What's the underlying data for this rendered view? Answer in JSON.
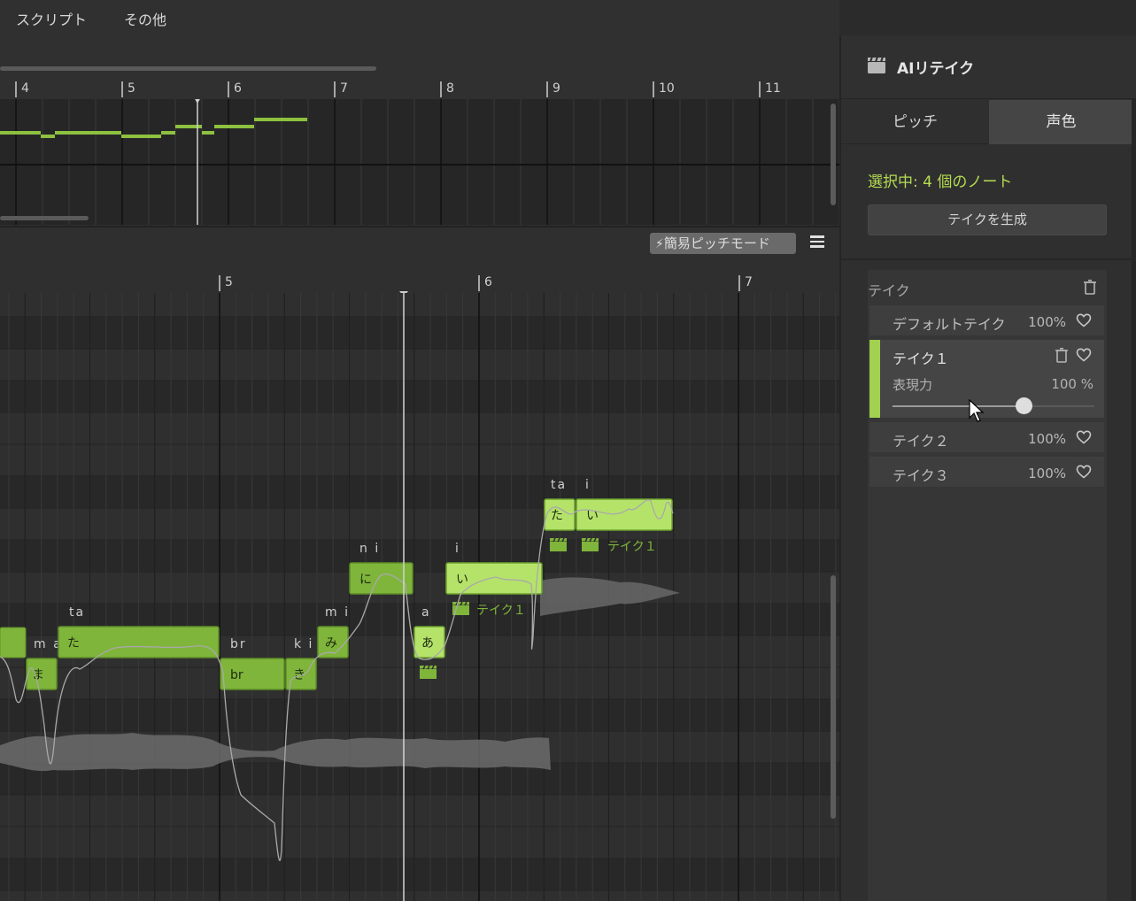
{
  "menu": {
    "items": [
      "スクリプト",
      "その他"
    ]
  },
  "overview": {
    "bars": [
      "4",
      "5",
      "6",
      "7",
      "8",
      "9",
      "10",
      "11"
    ]
  },
  "toolbar": {
    "pitch_mode_label": "簡易ピッチモード"
  },
  "ruler": {
    "bars": [
      "5",
      "6",
      "7"
    ]
  },
  "notes": [
    {
      "lyric": "ま",
      "phoneme": "m a",
      "take_icon": false,
      "take_label": ""
    },
    {
      "lyric": "た",
      "phoneme": "ta",
      "take_icon": false,
      "take_label": ""
    },
    {
      "lyric": "br",
      "phoneme": "br",
      "take_icon": false,
      "take_label": ""
    },
    {
      "lyric": "き",
      "phoneme": "k i",
      "take_icon": false,
      "take_label": ""
    },
    {
      "lyric": "み",
      "phoneme": "m i",
      "take_icon": false,
      "take_label": ""
    },
    {
      "lyric": "に",
      "phoneme": "n i",
      "take_icon": false,
      "take_label": ""
    },
    {
      "lyric": "あ",
      "phoneme": "a",
      "take_icon": true,
      "take_label": ""
    },
    {
      "lyric": "い",
      "phoneme": "i",
      "take_icon": true,
      "take_label": "テイク１"
    },
    {
      "lyric": "た",
      "phoneme": "ta",
      "take_icon": true,
      "take_label": ""
    },
    {
      "lyric": "い",
      "phoneme": "i",
      "take_icon": true,
      "take_label": "テイク１"
    }
  ],
  "panel": {
    "title": "AIリテイク",
    "tabs": {
      "pitch": "ピッチ",
      "timbre": "声色",
      "active": "timbre"
    },
    "selection_status": "選択中: 4 個のノート",
    "generate_button": "テイクを生成",
    "takes_label": "テイク",
    "takes": [
      {
        "name": "デフォルトテイク",
        "strength": "100%"
      },
      {
        "name": "テイク１",
        "expressiveness_label": "表現力",
        "expressiveness_value": "100 %",
        "expressiveness_level": 0.65,
        "selected": true
      },
      {
        "name": "テイク２",
        "strength": "100%"
      },
      {
        "name": "テイク３",
        "strength": "100%"
      }
    ]
  },
  "colors": {
    "accent": "#a2d14f",
    "note_fill": "#7fb53b",
    "note_fill_selected": "#b5e36a",
    "status_text": "#b4dc52",
    "background": "#2b2b2b"
  }
}
